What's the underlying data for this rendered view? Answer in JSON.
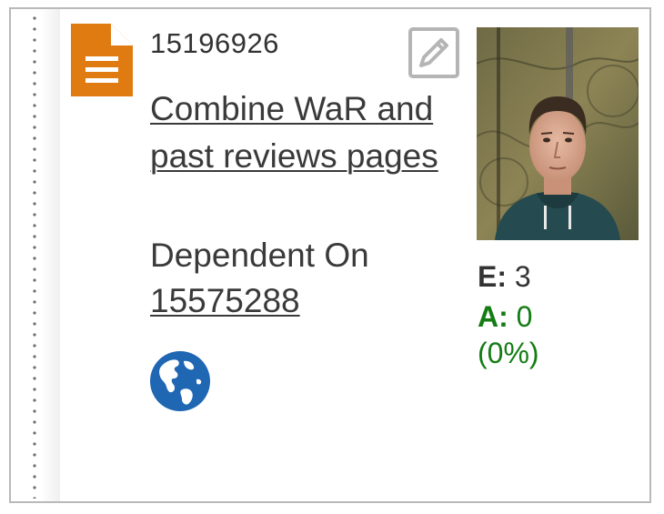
{
  "bug": {
    "id": "15196926",
    "title": "Combine WaR and past reviews pages",
    "dependency_label": "Dependent On",
    "dependency_id": "15575288"
  },
  "stats": {
    "e_label": "E:",
    "e_value": "3",
    "a_label": "A:",
    "a_value": "0",
    "a_percent": "(0%)"
  },
  "icons": {
    "type_icon": "document-icon",
    "edit_icon": "pencil-icon",
    "scope_icon": "globe-icon",
    "drag_icon": "drag-handle-icon"
  },
  "colors": {
    "doc_icon": "#e07b12",
    "globe": "#1f66b3",
    "accepted": "#137d13",
    "text": "#3a3a3a",
    "border": "#b9b9b9"
  }
}
